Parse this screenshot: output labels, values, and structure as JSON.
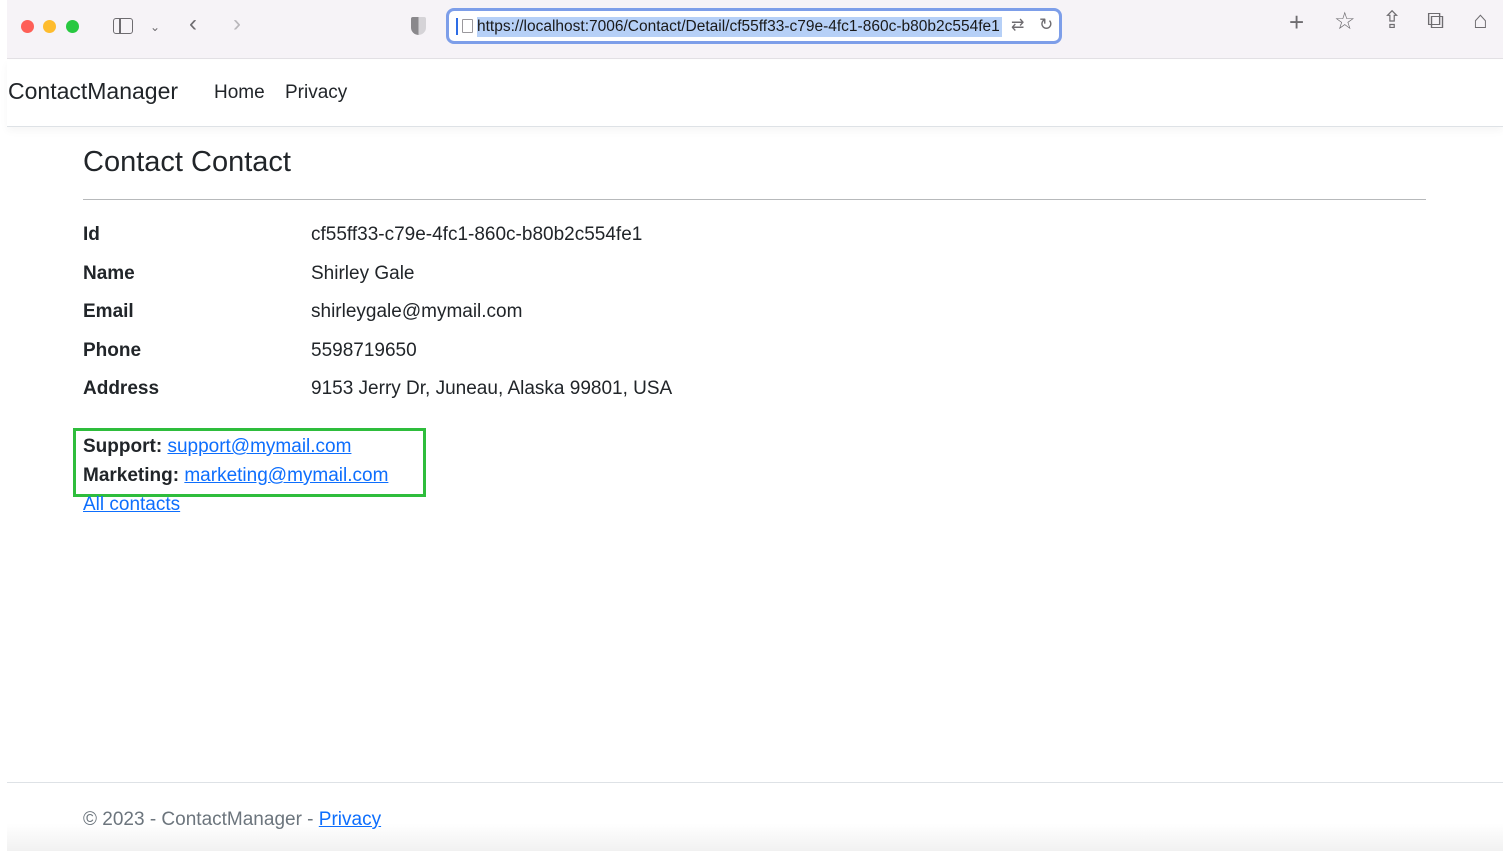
{
  "browser": {
    "url": "https://localhost:7006/Contact/Detail/cf55ff33-c79e-4fc1-860c-b80b2c554fe1",
    "icons": {
      "back": "chevron-left-icon",
      "forward": "chevron-right-icon",
      "sidebar": "sidebar-icon",
      "shield": "shield-icon",
      "translate": "translate-icon",
      "reload": "reload-icon",
      "new_tab": "plus-icon",
      "bookmark": "star-icon",
      "share": "share-icon",
      "tabs": "tab-overview-icon",
      "home": "home-icon"
    }
  },
  "nav": {
    "brand": "ContactManager",
    "home": "Home",
    "privacy": "Privacy"
  },
  "page": {
    "title": "Contact Contact",
    "details": [
      {
        "label": "Id",
        "value": "cf55ff33-c79e-4fc1-860c-b80b2c554fe1"
      },
      {
        "label": "Name",
        "value": "Shirley Gale"
      },
      {
        "label": "Email",
        "value": "shirleygale@mymail.com"
      },
      {
        "label": "Phone",
        "value": "5598719650"
      },
      {
        "label": "Address",
        "value": "9153 Jerry Dr, Juneau, Alaska 99801, USA"
      }
    ],
    "support_label": "Support:",
    "support_email": "support@mymail.com",
    "marketing_label": "Marketing:",
    "marketing_email": "marketing@mymail.com",
    "all_contacts": "All contacts"
  },
  "footer": {
    "text": "© 2023 - ContactManager - ",
    "privacy": "Privacy"
  },
  "colors": {
    "link": "#0d6efd",
    "highlight": "#2ebd3c",
    "urlbar_focus": "#7d9ee9"
  }
}
